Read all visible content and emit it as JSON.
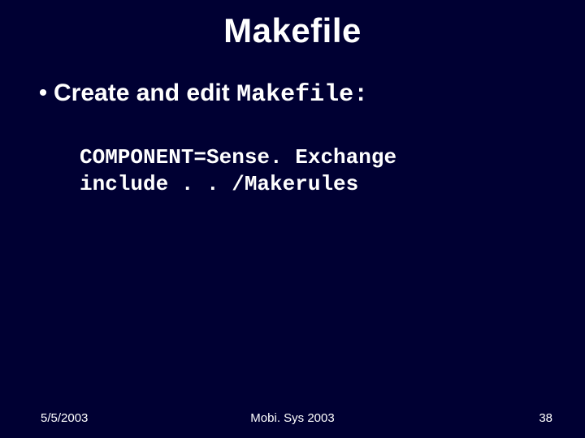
{
  "title": "Makefile",
  "bullet": {
    "dot": "•",
    "prefix": "Create and edit ",
    "mono": "Makefile:"
  },
  "code": {
    "line1": "COMPONENT=Sense. Exchange",
    "line2": "include . . /Makerules"
  },
  "footer": {
    "date": "5/5/2003",
    "venue": "Mobi. Sys 2003",
    "page": "38"
  }
}
